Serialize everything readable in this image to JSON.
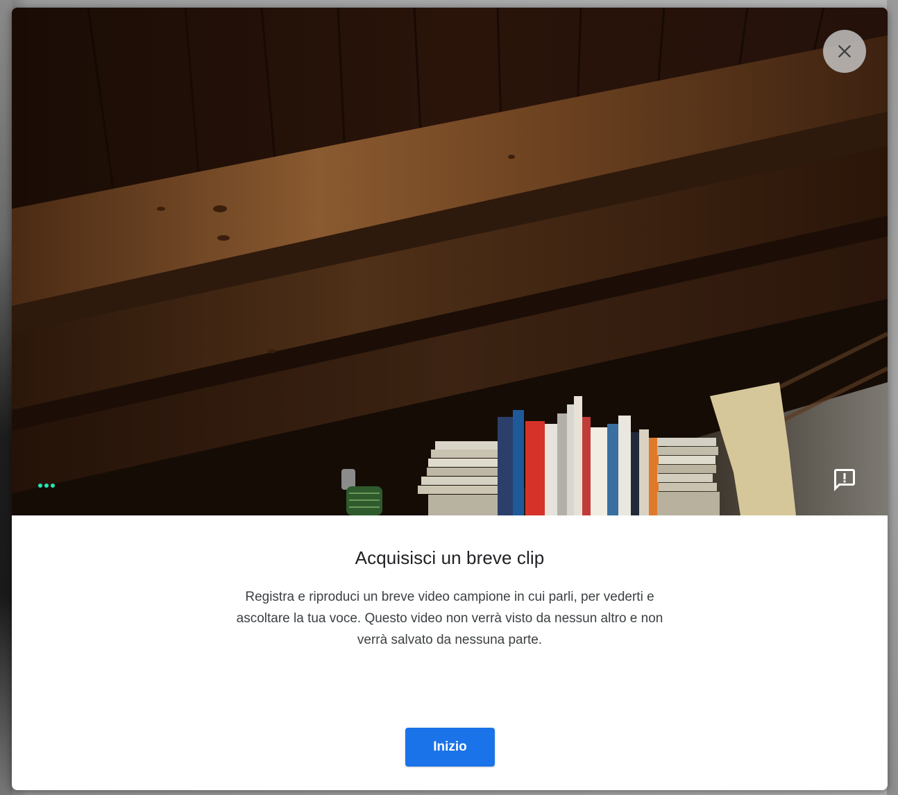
{
  "dialog": {
    "close_label": "Chiudi",
    "title": "Acquisisci un breve clip",
    "description": "Registra e riproduci un breve video campione in cui parli, per vederti e ascoltare la tua voce. Questo video non verrà visto da nessun altro e non verrà salvato da nessuna parte.",
    "start_button": "Inizio"
  },
  "video_preview": {
    "mic_indicator_icon": "audio-level-dots-icon",
    "feedback_icon": "feedback-icon",
    "close_icon": "close-icon"
  },
  "colors": {
    "accent": "#1a73e8",
    "mic_active": "#1de9b6",
    "title_text": "#202124",
    "body_text": "#3c4043"
  }
}
